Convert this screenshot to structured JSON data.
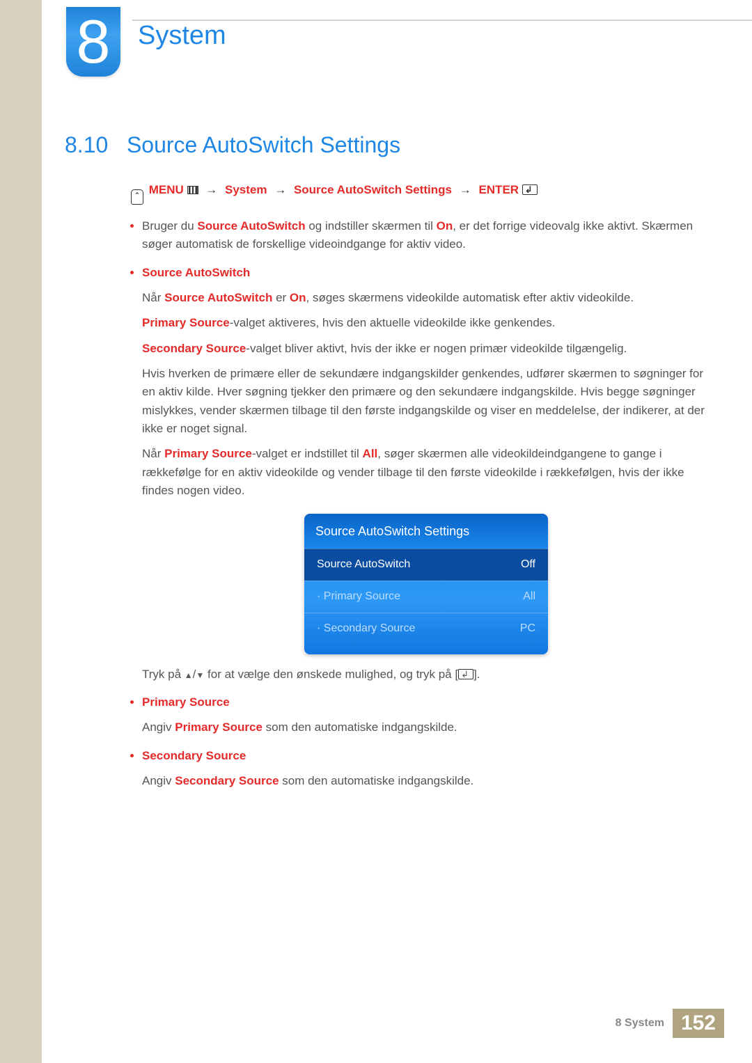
{
  "chapter": {
    "number": "8",
    "title": "System"
  },
  "section": {
    "number": "8.10",
    "title": "Source AutoSwitch Settings"
  },
  "nav_path": {
    "menu": "MENU",
    "system": "System",
    "settings": "Source AutoSwitch Settings",
    "enter": "ENTER"
  },
  "body": {
    "intro": {
      "hl1": "Source AutoSwitch",
      "t1": " og indstiller skærmen til ",
      "hl2": "On",
      "t2": ", er det forrige videovalg ikke aktivt. Skærmen søger automatisk de forskellige videoindgange for aktiv video.",
      "prefix": "Bruger du "
    },
    "sa": {
      "heading": "Source AutoSwitch",
      "p1_a": "Når ",
      "p1_hl1": "Source AutoSwitch",
      "p1_b": " er ",
      "p1_hl2": "On",
      "p1_c": ", søges skærmens videokilde automatisk efter aktiv videokilde.",
      "p2_hl": "Primary Source",
      "p2_t": "-valget aktiveres, hvis den aktuelle videokilde ikke genkendes.",
      "p3_hl": "Secondary Source",
      "p3_t": "-valget bliver aktivt, hvis der ikke er nogen primær videokilde tilgængelig.",
      "p4": "Hvis hverken de primære eller de sekundære indgangskilder genkendes, udfører skærmen to søgninger for en aktiv kilde. Hver søgning tjekker den primære og den sekundære indgangskilde. Hvis begge søgninger mislykkes, vender skærmen tilbage til den første indgangskilde og viser en meddelelse, der indikerer, at der ikke er noget signal.",
      "p5_a": "Når ",
      "p5_hl1": "Primary Source",
      "p5_b": "-valget er indstillet til ",
      "p5_hl2": "All",
      "p5_c": ", søger skærmen alle videokildeindgangene to gange i rækkefølge for en aktiv videokilde og vender tilbage til den første videokilde i rækkefølgen, hvis der ikke findes nogen video."
    },
    "osd": {
      "title": "Source AutoSwitch Settings",
      "rows": [
        {
          "label": "Source AutoSwitch",
          "value": "Off",
          "selected": true
        },
        {
          "label": "· Primary Source",
          "value": "All",
          "selected": false
        },
        {
          "label": "· Secondary Source",
          "value": "PC",
          "selected": false
        }
      ]
    },
    "nav_hint_a": "Tryk på ",
    "nav_hint_b": " for at vælge den ønskede mulighed, og tryk på [",
    "nav_hint_c": "].",
    "primary": {
      "heading": "Primary Source",
      "t_a": "Angiv ",
      "t_hl": "Primary Source",
      "t_b": " som den automatiske indgangskilde."
    },
    "secondary": {
      "heading": "Secondary Source",
      "t_a": "Angiv ",
      "t_hl": "Secondary Source",
      "t_b": " som den automatiske indgangskilde."
    }
  },
  "footer": {
    "label": "8 System",
    "page": "152"
  }
}
